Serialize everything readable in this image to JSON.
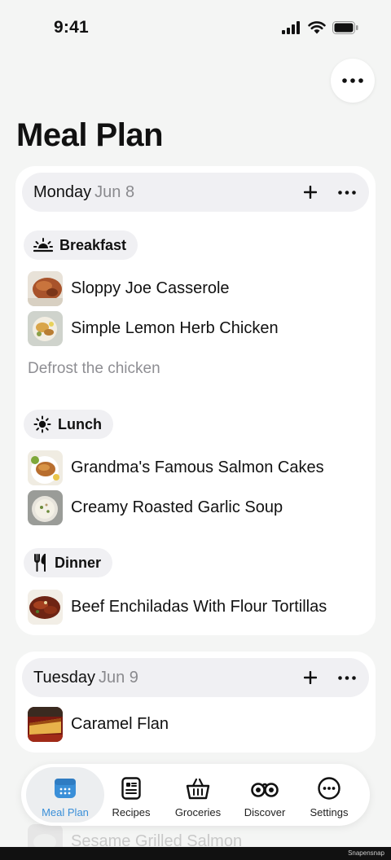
{
  "status_bar": {
    "time": "9:41"
  },
  "page": {
    "title": "Meal Plan"
  },
  "days": {
    "monday": {
      "weekday": "Monday",
      "date": "Jun 8",
      "meals": {
        "breakfast": {
          "label": "Breakfast",
          "icon": "sunrise-icon",
          "recipes": [
            "Sloppy Joe Casserole",
            "Simple Lemon Herb Chicken"
          ],
          "note": "Defrost the chicken"
        },
        "lunch": {
          "label": "Lunch",
          "icon": "sun-icon",
          "recipes": [
            "Grandma's Famous Salmon Cakes",
            "Creamy Roasted Garlic Soup"
          ]
        },
        "dinner": {
          "label": "Dinner",
          "icon": "fork-knife-icon",
          "recipes": [
            "Beef Enchiladas With Flour Tortillas"
          ]
        }
      }
    },
    "tuesday": {
      "weekday": "Tuesday",
      "date": "Jun 9",
      "recipes": [
        "Caramel Flan"
      ]
    }
  },
  "behind_content": {
    "recipe": "Sesame Grilled Salmon"
  },
  "tab_bar": {
    "items": [
      {
        "label": "Meal Plan",
        "icon": "calendar-icon",
        "active": true
      },
      {
        "label": "Recipes",
        "icon": "recipe-book-icon",
        "active": false
      },
      {
        "label": "Groceries",
        "icon": "basket-icon",
        "active": false
      },
      {
        "label": "Discover",
        "icon": "binoculars-icon",
        "active": false
      },
      {
        "label": "Settings",
        "icon": "settings-dots-icon",
        "active": false
      }
    ]
  },
  "watermark": "Snapensnap",
  "colors": {
    "accent": "#3a8fd8",
    "secondary_text": "#8a8a8e",
    "pill_bg": "#f0f0f3"
  }
}
